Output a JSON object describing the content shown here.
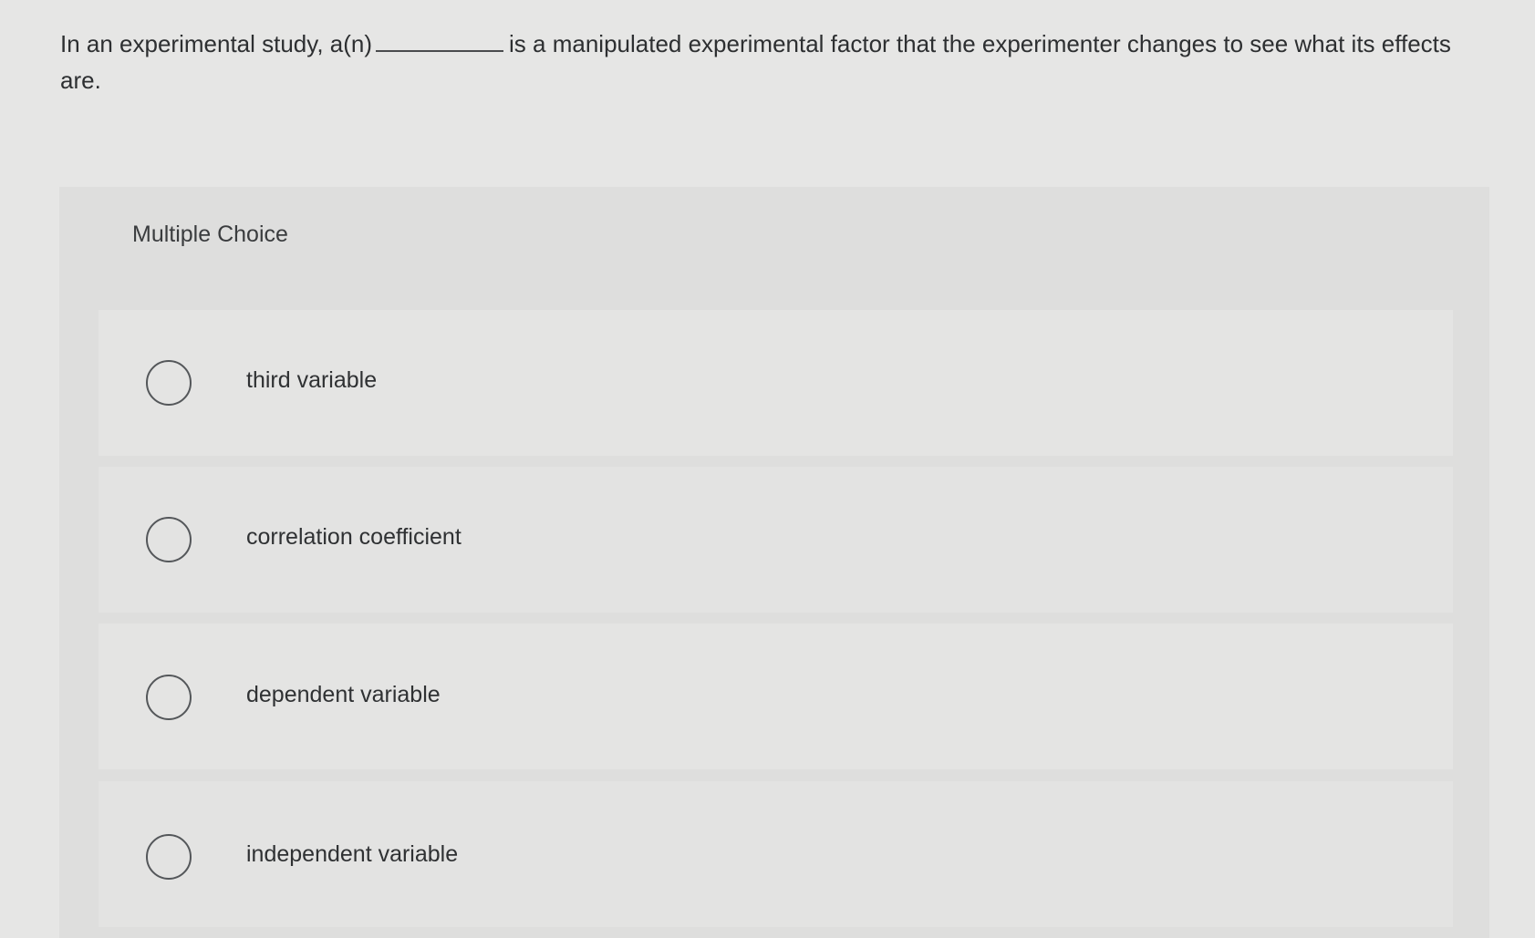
{
  "question": {
    "text_before_blank": "In an experimental study, a(n)",
    "text_after_blank": "is a manipulated experimental factor that the experimenter changes to see what its effects are."
  },
  "multiple_choice": {
    "label": "Multiple Choice",
    "options": [
      {
        "label": "third variable",
        "selected": false
      },
      {
        "label": "correlation coefficient",
        "selected": false
      },
      {
        "label": "dependent variable",
        "selected": false
      },
      {
        "label": "independent variable",
        "selected": false
      }
    ]
  },
  "colors": {
    "page_background": "#e6e6e5",
    "panel_background": "#dededd",
    "text": "#2f3133",
    "radio_border": "#54575a"
  },
  "icons": {
    "radio": "radio-unselected-icon"
  }
}
